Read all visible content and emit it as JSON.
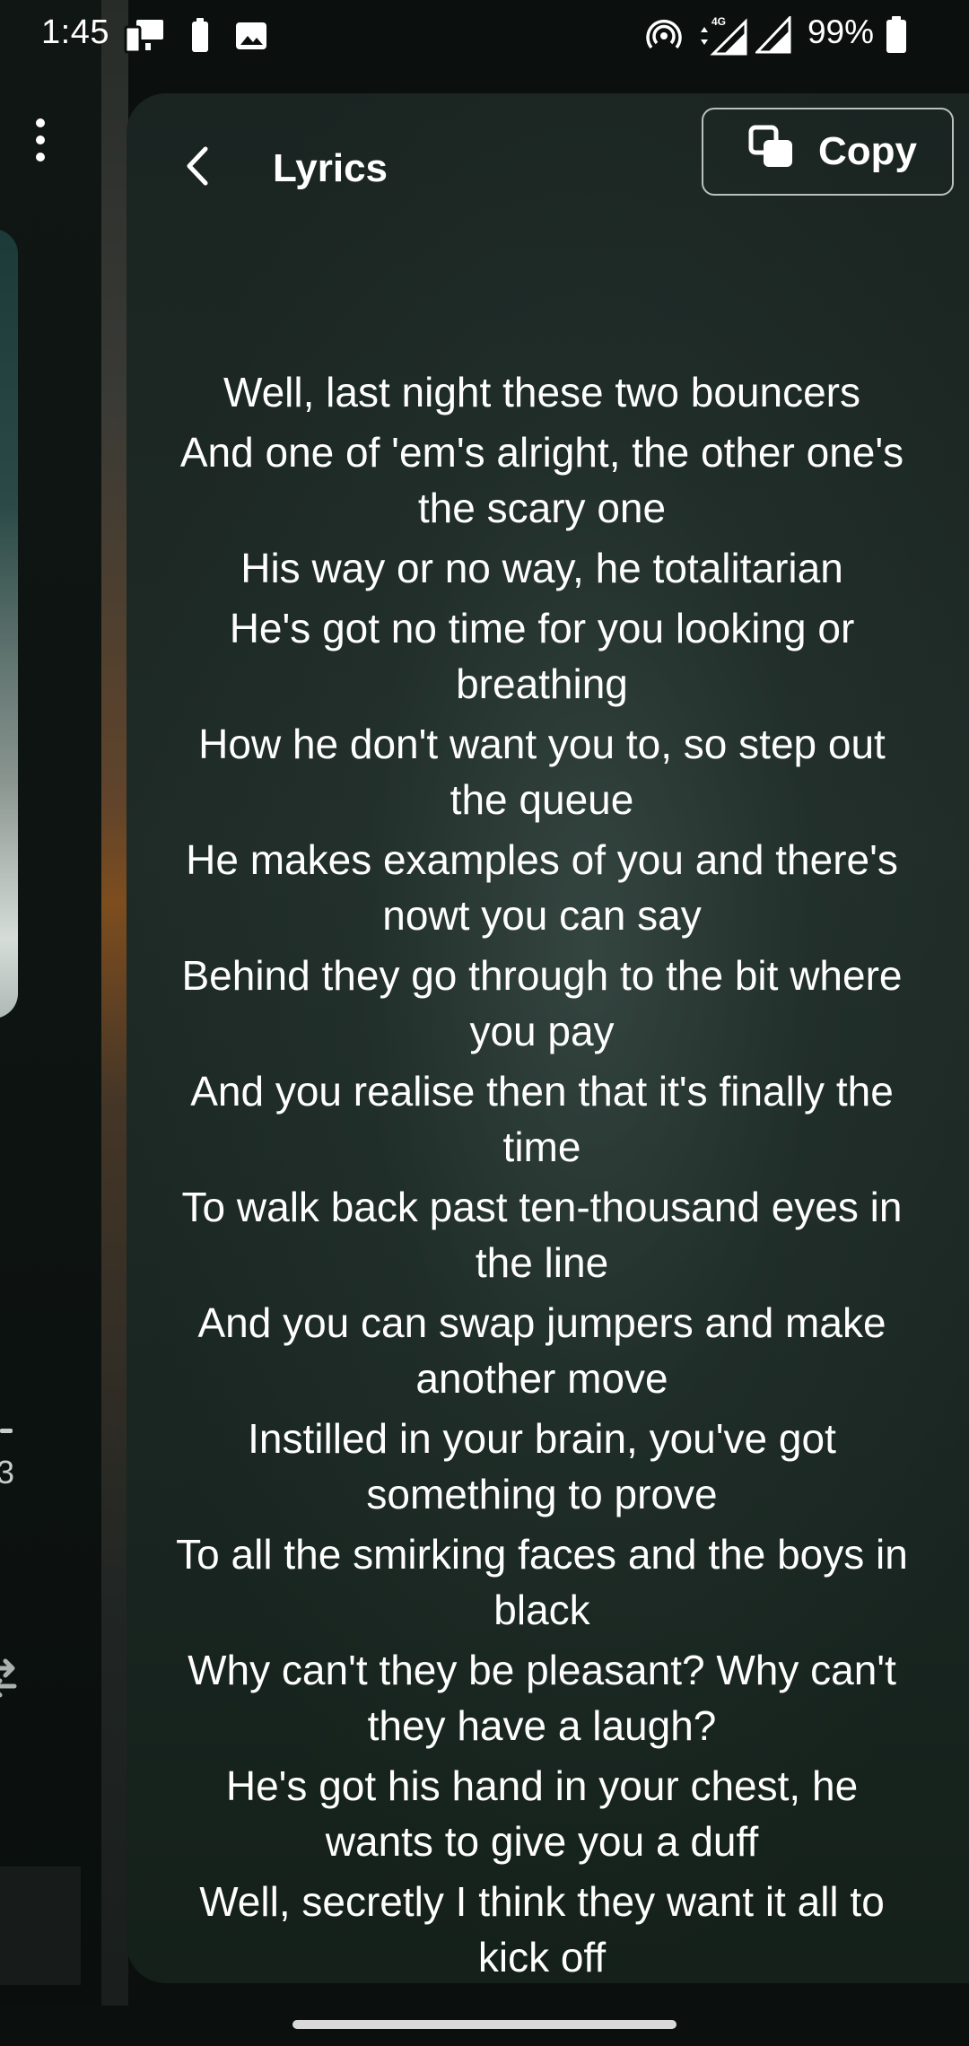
{
  "status_bar": {
    "time": "1:45",
    "battery_percent": "99%",
    "network_label": "4G",
    "icons": [
      "screen-mirror-icon",
      "battery-small-icon",
      "image-icon",
      "hotspot-icon",
      "signal-4g-icon",
      "signal-icon",
      "battery-icon"
    ]
  },
  "header": {
    "title": "Lyrics",
    "copy_label": "Copy"
  },
  "background_player": {
    "partial_text": "3",
    "icons": [
      "more-vert-icon",
      "repeat-icon"
    ]
  },
  "lyrics": [
    "Well, last night these two bouncers",
    "And one of 'em's alright, the other one's the scary one",
    "His way or no way, he totalitarian",
    "He's got no time for you looking or breathing",
    "How he don't want you to, so step out the queue",
    "He makes examples of you and there's nowt you can say",
    "Behind they go through to the bit where you pay",
    "And you realise then that it's finally the time",
    "To walk back past ten-thousand eyes in the line",
    "And you can swap jumpers and make another move",
    "Instilled in your brain, you've got something to prove",
    "To all the smirking faces and the boys in black",
    "Why can't they be pleasant? Why can't they have a laugh?",
    "He's got his hand in your chest, he wants to give you a duff",
    "Well, secretly I think they want it all to kick off"
  ],
  "colors": {
    "sheet_bg": "#1f2b27",
    "text": "#ffffff",
    "button_border": "#b9c0bd"
  }
}
